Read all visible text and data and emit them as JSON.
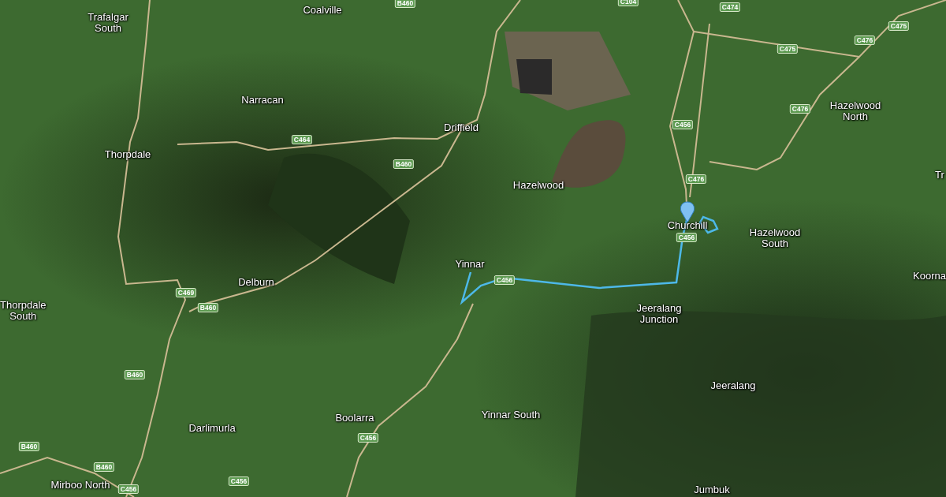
{
  "map": {
    "places": [
      {
        "name": "Trafalgar South"
      },
      {
        "name": "Coalville"
      },
      {
        "name": "Narracan"
      },
      {
        "name": "Thorpdale"
      },
      {
        "name": "Driffield"
      },
      {
        "name": "Hazelwood"
      },
      {
        "name": "Yinnar"
      },
      {
        "name": "Churchill"
      },
      {
        "name": "Hazelwood North"
      },
      {
        "name": "Hazelwood South"
      },
      {
        "name": "Tr"
      },
      {
        "name": "Koorna"
      },
      {
        "name": "Thorpdale South"
      },
      {
        "name": "Delburn"
      },
      {
        "name": "Jeeralang Junction"
      },
      {
        "name": "Jeeralang"
      },
      {
        "name": "Yinnar South"
      },
      {
        "name": "Boolarra"
      },
      {
        "name": "Darlimurla"
      },
      {
        "name": "Mirboo North"
      },
      {
        "name": "Jumbuk"
      }
    ],
    "road_shields": [
      {
        "label": "B460"
      },
      {
        "label": "C104"
      },
      {
        "label": "C474"
      },
      {
        "label": "C475"
      },
      {
        "label": "C475"
      },
      {
        "label": "C476"
      },
      {
        "label": "C476"
      },
      {
        "label": "C456"
      },
      {
        "label": "C476"
      },
      {
        "label": "C456"
      },
      {
        "label": "C456"
      },
      {
        "label": "C464"
      },
      {
        "label": "B460"
      },
      {
        "label": "C469"
      },
      {
        "label": "B460"
      },
      {
        "label": "B460"
      },
      {
        "label": "B460"
      },
      {
        "label": "B460"
      },
      {
        "label": "C456"
      },
      {
        "label": "C456"
      },
      {
        "label": "C456"
      }
    ]
  }
}
